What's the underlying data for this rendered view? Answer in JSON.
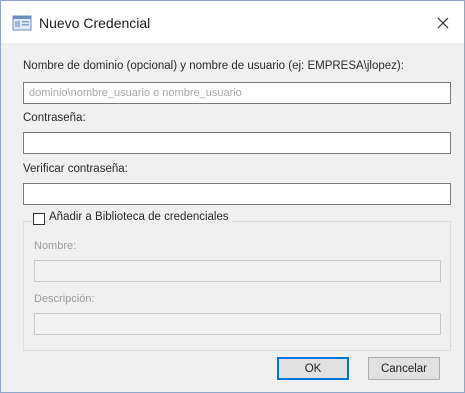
{
  "window": {
    "title": "Nuevo Credencial",
    "icon": "credential-app-icon",
    "close_icon": "close-icon"
  },
  "form": {
    "domain_user_label": "Nombre de dominio (opcional) y nombre de usuario (ej: EMPRESA\\jlopez):",
    "domain_user_placeholder": "dominio\\nombre_usuario o nombre_usuario",
    "password_label": "Contraseña:",
    "verify_password_label": "Verificar contraseña:"
  },
  "library": {
    "checkbox_label": "Añadir a Biblioteca de credenciales",
    "checked": false,
    "name_label": "Nombre:",
    "description_label": "Descripción:"
  },
  "buttons": {
    "ok": "OK",
    "cancel": "Cancelar"
  }
}
